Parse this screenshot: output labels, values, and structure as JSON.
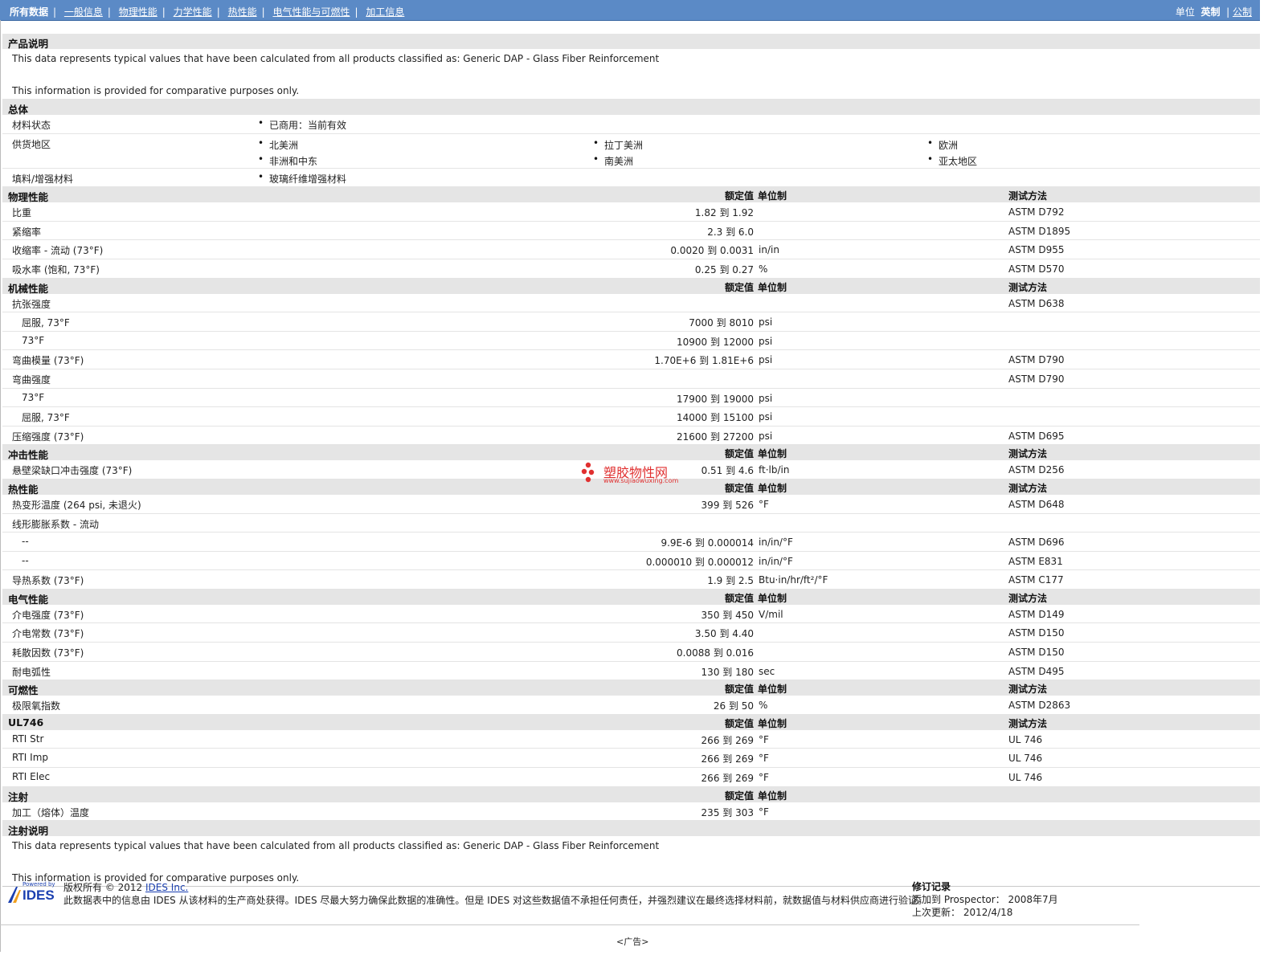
{
  "nav": {
    "items": [
      "所有数据",
      "一般信息",
      "物理性能",
      "力学性能",
      "热性能",
      "电气性能与可燃性",
      "加工信息"
    ],
    "units_label": "单位",
    "units_current": "英制",
    "units_alt": "公制"
  },
  "product_desc": {
    "title": "产品说明",
    "line1": "This data represents typical values that have been calculated from all products classified as: Generic DAP - Glass Fiber Reinforcement",
    "line2": "This information is provided for comparative purposes only."
  },
  "general": {
    "title": "总体",
    "status_label": "材料状态",
    "status_value": "已商用：当前有效",
    "regions_label": "供货地区",
    "regions": [
      "北美洲",
      "拉丁美洲",
      "欧洲",
      "非洲和中东",
      "南美洲",
      "亚太地区"
    ],
    "filler_label": "填料/增强材料",
    "filler_value": "玻璃纤维增强材料"
  },
  "headers": {
    "nominal": "额定值",
    "unit": "单位制",
    "test": "测试方法"
  },
  "sections": [
    {
      "title": "物理性能",
      "show_test": true,
      "rows": [
        {
          "label": "比重",
          "value": "1.82 到  1.92",
          "unit": "",
          "test": "ASTM D792"
        },
        {
          "label": "紧缩率",
          "value": "2.3 到  6.0",
          "unit": "",
          "test": "ASTM D1895"
        },
        {
          "label": "收缩率 - 流动 (73°F)",
          "value": "0.0020 到  0.0031",
          "unit": "in/in",
          "test": "ASTM D955"
        },
        {
          "label": "吸水率 (饱和, 73°F)",
          "value": "0.25 到  0.27",
          "unit": "%",
          "test": "ASTM D570"
        }
      ]
    },
    {
      "title": "机械性能",
      "show_test": true,
      "rows": [
        {
          "label": "抗张强度",
          "value": "",
          "unit": "",
          "test": "ASTM D638"
        },
        {
          "label": "屈服, 73°F",
          "indent": true,
          "value": "7000 到  8010",
          "unit": "psi",
          "test": ""
        },
        {
          "label": "73°F",
          "indent": true,
          "value": "10900 到  12000",
          "unit": "psi",
          "test": ""
        },
        {
          "label": "弯曲模量 (73°F)",
          "value": "1.70E+6 到  1.81E+6",
          "unit": "psi",
          "test": "ASTM D790"
        },
        {
          "label": "弯曲强度",
          "value": "",
          "unit": "",
          "test": "ASTM D790"
        },
        {
          "label": "73°F",
          "indent": true,
          "value": "17900 到  19000",
          "unit": "psi",
          "test": ""
        },
        {
          "label": "屈服, 73°F",
          "indent": true,
          "value": "14000 到  15100",
          "unit": "psi",
          "test": ""
        },
        {
          "label": "压缩强度 (73°F)",
          "value": "21600 到  27200",
          "unit": "psi",
          "test": "ASTM D695"
        }
      ]
    },
    {
      "title": "冲击性能",
      "show_test": true,
      "rows": [
        {
          "label": "悬壁梁缺口冲击强度 (73°F)",
          "value": "0.51 到  4.6",
          "unit": "ft·lb/in",
          "test": "ASTM D256"
        }
      ]
    },
    {
      "title": "热性能",
      "show_test": true,
      "rows": [
        {
          "label": "热变形温度 (264 psi, 未退火)",
          "value": "399 到  526",
          "unit": "°F",
          "test": "ASTM D648"
        },
        {
          "label": "线形膨胀系数 - 流动",
          "value": "",
          "unit": "",
          "test": ""
        },
        {
          "label": "--",
          "indent": true,
          "value": "9.9E-6 到  0.000014",
          "unit": "in/in/°F",
          "test": "ASTM D696"
        },
        {
          "label": "--",
          "indent": true,
          "value": "0.000010 到  0.000012",
          "unit": "in/in/°F",
          "test": "ASTM E831"
        },
        {
          "label": "导热系数 (73°F)",
          "value": "1.9 到  2.5",
          "unit": "Btu·in/hr/ft²/°F",
          "test": "ASTM C177"
        }
      ]
    },
    {
      "title": "电气性能",
      "show_test": true,
      "rows": [
        {
          "label": "介电强度 (73°F)",
          "value": "350 到  450",
          "unit": "V/mil",
          "test": "ASTM D149"
        },
        {
          "label": "介电常数 (73°F)",
          "value": "3.50 到  4.40",
          "unit": "",
          "test": "ASTM D150"
        },
        {
          "label": "耗散因数 (73°F)",
          "value": "0.0088 到  0.016",
          "unit": "",
          "test": "ASTM D150"
        },
        {
          "label": "耐电弧性",
          "value": "130 到  180",
          "unit": "sec",
          "test": "ASTM D495"
        }
      ]
    },
    {
      "title": "可燃性",
      "show_test": true,
      "rows": [
        {
          "label": "极限氧指数",
          "value": "26 到  50",
          "unit": "%",
          "test": "ASTM D2863"
        }
      ]
    },
    {
      "title": "UL746",
      "show_test": true,
      "rows": [
        {
          "label": "RTI Str",
          "value": "266 到  269",
          "unit": "°F",
          "test": "UL 746"
        },
        {
          "label": "RTI Imp",
          "value": "266 到  269",
          "unit": "°F",
          "test": "UL 746"
        },
        {
          "label": "RTI Elec",
          "value": "266 到  269",
          "unit": "°F",
          "test": "UL 746"
        }
      ]
    },
    {
      "title": "注射",
      "show_test": false,
      "rows": [
        {
          "label": "加工（熔体）温度",
          "value": "235 到  303",
          "unit": "°F",
          "test": ""
        }
      ]
    }
  ],
  "injection_desc": {
    "title": "注射说明",
    "line1": "This data represents typical values that have been calculated from all products classified as: Generic DAP - Glass Fiber Reinforcement",
    "line2": "This information is provided for comparative purposes only."
  },
  "footer": {
    "logo_small": "Powered by",
    "logo_text": "IDES",
    "copyright_prefix": "版权所有 © 2012",
    "copyright_link": "IDES Inc.",
    "disclaimer": "此数据表中的信息由 IDES 从该材料的生产商处获得。IDES 尽最大努力确保此数据的准确性。但是 IDES 对这些数据值不承担任何责任，并强烈建议在最终选择材料前，就数据值与材料供应商进行验证。",
    "rev_title": "修订记录",
    "rev_added": "添加到 Prospector： 2008年7月",
    "rev_updated": "上次更新： 2012/4/18",
    "ad": "<广告>"
  },
  "watermark": {
    "text": "塑胶物性网",
    "sub": "www.sujiaowuxing.com"
  },
  "colors": {
    "topbar": "#5b8ac6",
    "section_header": "#e5e5e5",
    "link": "#1a3fb0",
    "watermark": "#e03030"
  }
}
